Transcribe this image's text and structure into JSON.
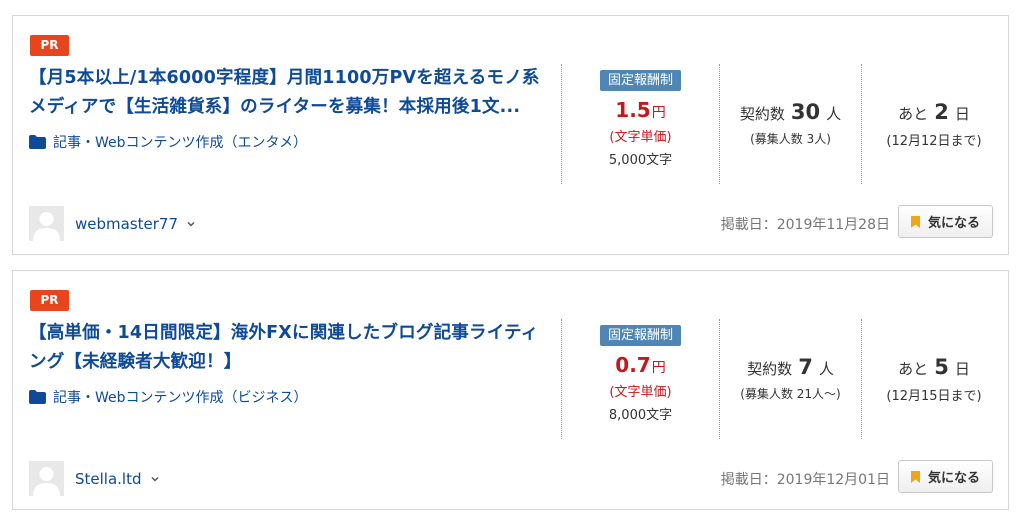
{
  "jobs": [
    {
      "pr": "PR",
      "title": "【月5本以上/1本6000字程度】月間1100万PVを超えるモノ系メディアで【生活雑貨系】のライターを募集！本採用後1文...",
      "category": "記事・Webコンテンツ作成（エンタメ）",
      "badge": "固定報酬制",
      "price": "1.5",
      "price_unit": "円",
      "price_type": "(文字単価)",
      "char_count": "5,000文字",
      "contract_label": "契約数",
      "contract_num": "30",
      "contract_unit": "人",
      "recruit": "(募集人数 3人)",
      "remain_label": "あと",
      "remain_num": "2",
      "remain_unit": "日",
      "deadline": "(12月12日まで)",
      "username": "webmaster77",
      "posted": "掲載日：2019年11月28日",
      "fav_label": "気になる"
    },
    {
      "pr": "PR",
      "title": "【高単価・14日間限定】海外FXに関連したブログ記事ライティング【未経験者大歓迎！】",
      "category": "記事・Webコンテンツ作成（ビジネス）",
      "badge": "固定報酬制",
      "price": "0.7",
      "price_unit": "円",
      "price_type": "(文字単価)",
      "char_count": "8,000文字",
      "contract_label": "契約数",
      "contract_num": "7",
      "contract_unit": "人",
      "recruit": "(募集人数 21人〜)",
      "remain_label": "あと",
      "remain_num": "5",
      "remain_unit": "日",
      "deadline": "(12月15日まで)",
      "username": "Stella.ltd",
      "posted": "掲載日：2019年12月01日",
      "fav_label": "気になる"
    }
  ],
  "colors": {
    "pr": "#e8451d",
    "link": "#0e4a96",
    "price": "#c8161d",
    "badge": "#4f86b4",
    "bookmark": "#f0a51a"
  },
  "icons": {
    "category": "folder-icon",
    "user_menu": "chevron-down-icon",
    "fav": "bookmark-icon",
    "avatar": "default-avatar"
  }
}
